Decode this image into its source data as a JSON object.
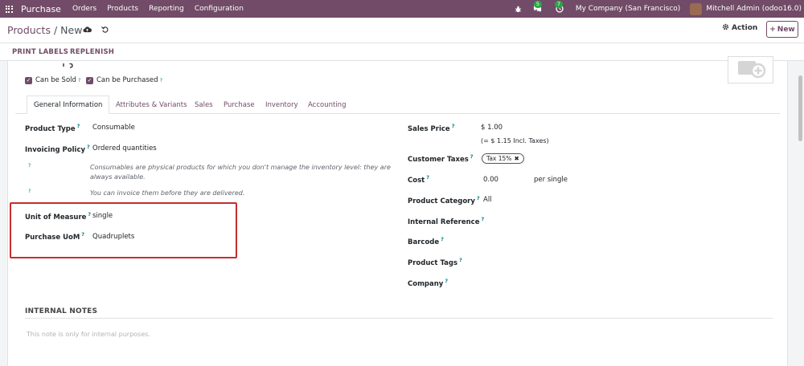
{
  "navbar": {
    "app_name": "Purchase",
    "menu": [
      "Orders",
      "Products",
      "Reporting",
      "Configuration"
    ],
    "messages_count": "5",
    "activities_count": "7",
    "company": "My Company (San Francisco)",
    "user": "Mitchell Admin (odoo16.0)"
  },
  "breadcrumb": {
    "parent": "Products",
    "separator": "/",
    "current": "New"
  },
  "control": {
    "action_label": "Action",
    "new_label": "New"
  },
  "statusbar": {
    "print_labels": "PRINT LABELS",
    "replenish": "REPLENISH"
  },
  "form": {
    "can_be_sold": "Can be Sold",
    "can_be_purchased": "Can be Purchased",
    "help_mark": "?",
    "tabs": [
      "General Information",
      "Attributes & Variants",
      "Sales",
      "Purchase",
      "Inventory",
      "Accounting"
    ],
    "left": {
      "product_type_label": "Product Type",
      "product_type_value": "Consumable",
      "invoicing_policy_label": "Invoicing Policy",
      "invoicing_policy_value": "Ordered quantities",
      "consumable_note": "Consumables are physical products for which you don't manage the inventory level: they are always available.",
      "invoice_note": "You can invoice them before they are delivered.",
      "uom_label": "Unit of Measure",
      "uom_value": "single",
      "purchase_uom_label": "Purchase UoM",
      "purchase_uom_value": "Quadruplets"
    },
    "right": {
      "sales_price_label": "Sales Price",
      "sales_price_value": "$ 1.00",
      "incl_taxes": "(= $ 1.15 Incl. Taxes)",
      "customer_taxes_label": "Customer Taxes",
      "tax_tag": "Tax 15%",
      "cost_label": "Cost",
      "cost_value": "0.00",
      "cost_unit": "per single",
      "category_label": "Product Category",
      "category_value": "All",
      "internal_ref_label": "Internal Reference",
      "barcode_label": "Barcode",
      "tags_label": "Product Tags",
      "company_label": "Company"
    },
    "internal_notes_title": "INTERNAL NOTES",
    "internal_notes_placeholder": "This note is only for internal purposes."
  },
  "colors": {
    "brand": "#714b67",
    "highlight": "#c72d2d",
    "badge": "#28a745"
  }
}
